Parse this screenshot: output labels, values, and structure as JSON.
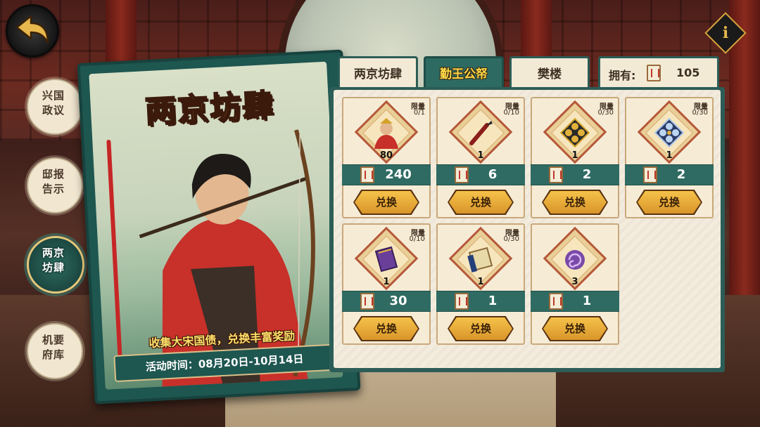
{
  "banner": {
    "title": "两京坊肆",
    "slogan": "收集大宋国债，兑换丰富奖励",
    "time": "活动时间：08月20日-10月14日"
  },
  "nav": [
    {
      "label": "兴国\n政议",
      "active": false
    },
    {
      "label": "邸报\n告示",
      "active": false
    },
    {
      "label": "两京\n坊肆",
      "active": true
    },
    {
      "label": "机要\n府库",
      "active": false
    }
  ],
  "tabs": [
    {
      "label": "两京坊肆",
      "active": false
    },
    {
      "label": "勤王公帑",
      "active": true
    },
    {
      "label": "樊楼",
      "active": false
    }
  ],
  "currency": {
    "label": "拥有:",
    "value": "105",
    "icon": "bond-token-icon"
  },
  "shop": {
    "limit_heading": "限量",
    "exchange_label": "兑换",
    "items": [
      {
        "icon": "general-portrait-icon",
        "limit": "0/1",
        "qty": "80",
        "price": "240"
      },
      {
        "icon": "brush-icon",
        "limit": "0/10",
        "qty": "1",
        "price": "6"
      },
      {
        "icon": "gold-flower-gem-icon",
        "limit": "0/30",
        "qty": "1",
        "price": "2"
      },
      {
        "icon": "blue-flower-gem-icon",
        "limit": "0/30",
        "qty": "1",
        "price": "2"
      },
      {
        "icon": "purple-book-icon",
        "limit": "0/10",
        "qty": "1",
        "price": "30"
      },
      {
        "icon": "scroll-icon",
        "limit": "0/30",
        "qty": "1",
        "price": "1"
      },
      {
        "icon": "purple-swirl-orb-icon",
        "limit": "",
        "qty": "3",
        "price": "1"
      }
    ]
  },
  "colors": {
    "teal": "#2c5d57",
    "gold": "#ffd94a",
    "parchment": "#f3ecdd",
    "red": "#c62626"
  }
}
